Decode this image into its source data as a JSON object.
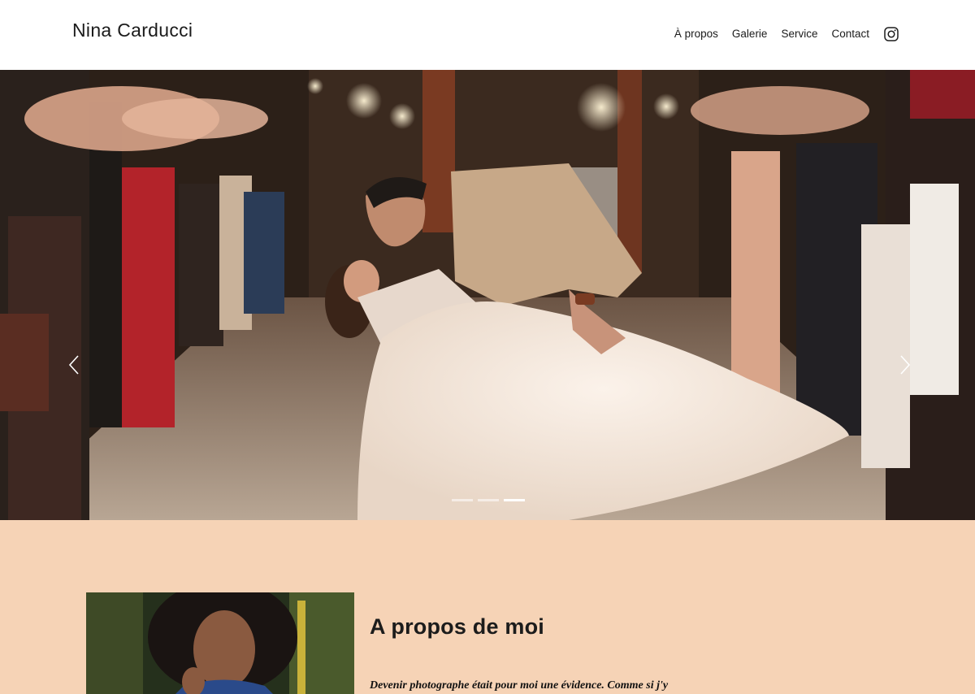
{
  "header": {
    "brand": "Nina Carducci",
    "nav": [
      {
        "label": "À propos"
      },
      {
        "label": "Galerie"
      },
      {
        "label": "Service"
      },
      {
        "label": "Contact"
      }
    ],
    "instagram_icon": "instagram-icon"
  },
  "carousel": {
    "prev_icon": "chevron-left-icon",
    "next_icon": "chevron-right-icon",
    "slide_count": 3,
    "active_slide": 3
  },
  "about": {
    "title": "A propos de moi",
    "text": "Devenir photographe était pour moi une évidence. Comme si j'y"
  },
  "colors": {
    "header_bg": "#ffffff",
    "about_bg": "#f6d3b6",
    "text": "#1b1b1b"
  }
}
